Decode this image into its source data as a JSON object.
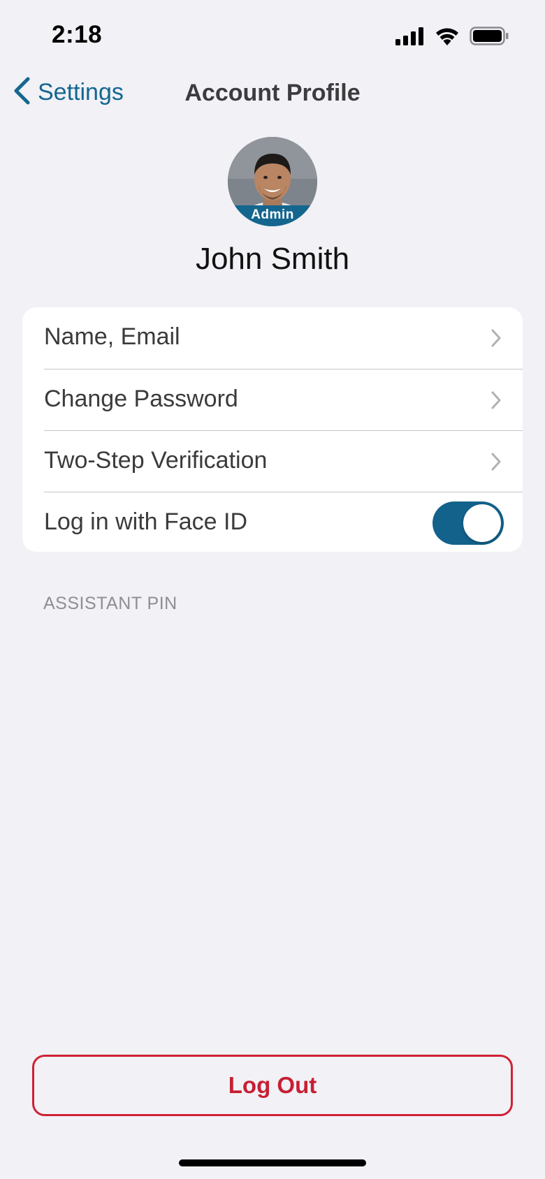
{
  "status_bar": {
    "time": "2:18",
    "icons": [
      "cellular-signal-icon",
      "wifi-icon",
      "battery-icon"
    ]
  },
  "nav": {
    "back_label": "Settings",
    "title": "Account Profile"
  },
  "profile": {
    "badge": "Admin",
    "name": "John Smith"
  },
  "settings_rows": [
    {
      "label": "Name, Email",
      "accessory": "chevron-right-icon"
    },
    {
      "label": "Change Password",
      "accessory": "chevron-right-icon"
    },
    {
      "label": "Two-Step Verification",
      "accessory": "chevron-right-icon"
    },
    {
      "label": "Log in with Face ID",
      "accessory": "toggle",
      "toggle_on": true
    }
  ],
  "section_header": "ASSISTANT PIN",
  "logout_label": "Log Out",
  "colors": {
    "accent": "#14668f",
    "destructive": "#cf2135",
    "background": "#f1f1f6"
  }
}
